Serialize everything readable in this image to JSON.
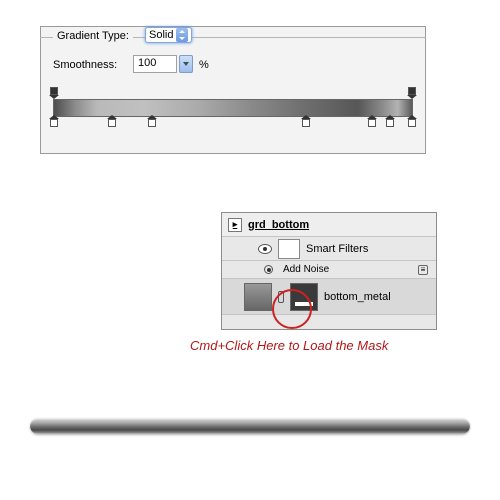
{
  "gradient_panel": {
    "type_label": "Gradient Type:",
    "type_value": "Solid",
    "smoothness_label": "Smoothness:",
    "smoothness_value": "100",
    "percent": "%",
    "opacity_stops_pct": [
      0,
      100
    ],
    "color_stops_pct": [
      0,
      16,
      27,
      70,
      88,
      93,
      100
    ]
  },
  "layers_panel": {
    "group_name": "grd_bottom",
    "smart_filters_label": "Smart Filters",
    "filter_name": "Add Noise",
    "layer_name": "bottom_metal"
  },
  "annotation": {
    "text": "Cmd+Click Here to Load the Mask"
  }
}
